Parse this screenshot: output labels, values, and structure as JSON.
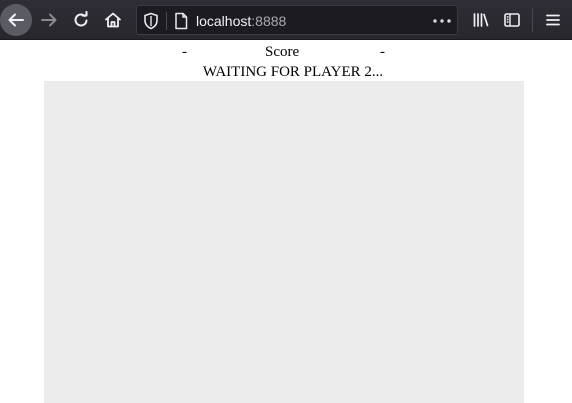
{
  "browser": {
    "url_host": "localhost",
    "url_port": ":8888",
    "icons": {
      "back": "back-arrow-icon",
      "forward": "forward-arrow-icon",
      "reload": "reload-icon",
      "home": "home-icon",
      "tracking": "tracking-shield-icon",
      "page": "page-icon",
      "more": "more-actions-icon",
      "library": "library-icon",
      "sidebar": "sidebar-icon",
      "menu": "hamburger-menu-icon"
    },
    "colors": {
      "toolbar": "#2b2a33",
      "urlbar": "#1c1b22"
    }
  },
  "game": {
    "player1_score": "-",
    "score_label": "Score",
    "player2_score": "-",
    "status": "WAITING FOR PLAYER 2...",
    "canvas_color": "#ececec"
  }
}
